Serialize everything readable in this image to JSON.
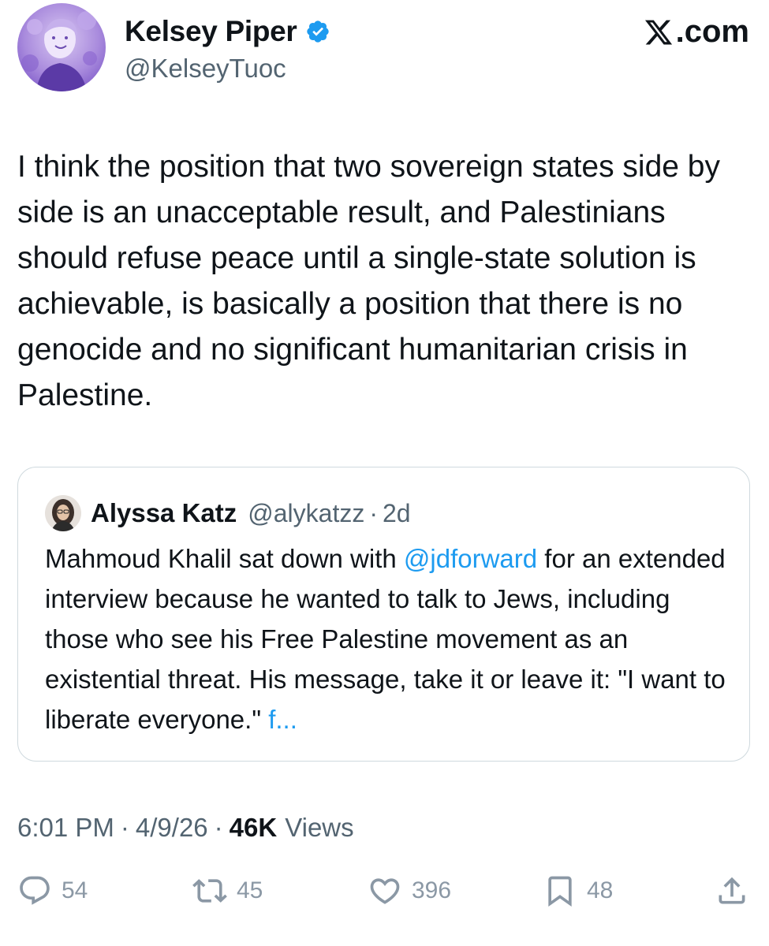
{
  "post": {
    "author_name": "Kelsey Piper",
    "author_handle": "@KelseyTuoc",
    "site_label": ".com",
    "text": "I think the position that two sovereign states side by side is an unacceptable result, and Palestinians should refuse peace until a single-state solution is achievable, is basically a position that there is no genocide and no significant humanitarian crisis in Palestine."
  },
  "quote": {
    "author_name": "Alyssa Katz",
    "author_handle": "@alykatzz",
    "separator": "·",
    "time": "2d",
    "text_before": "Mahmoud Khalil sat down with ",
    "mention": "@jdforward",
    "text_after": " for an extended interview because he wanted to talk to Jews, including those who see his Free Palestine movement as an existential threat. His message, take it or leave it: \"I want to liberate everyone.\" ",
    "truncated_link": "f..."
  },
  "meta": {
    "time": "6:01 PM",
    "separator": "·",
    "date": "4/9/26",
    "views_count": "46K",
    "views_label": "Views"
  },
  "actions": {
    "reply_count": "54",
    "repost_count": "45",
    "like_count": "396",
    "bookmark_count": "48"
  },
  "icons": {
    "verified": "verified-badge-icon",
    "site": "x-logo-icon",
    "reply": "reply-icon",
    "repost": "repost-icon",
    "like": "heart-icon",
    "bookmark": "bookmark-icon",
    "share": "share-icon"
  },
  "colors": {
    "accent": "#1d9bf0",
    "text": "#0f1419",
    "secondary": "#536471",
    "action_gray": "#8b98a5",
    "border": "#cfd9de",
    "avatar_purple": "#9b7fd4"
  }
}
